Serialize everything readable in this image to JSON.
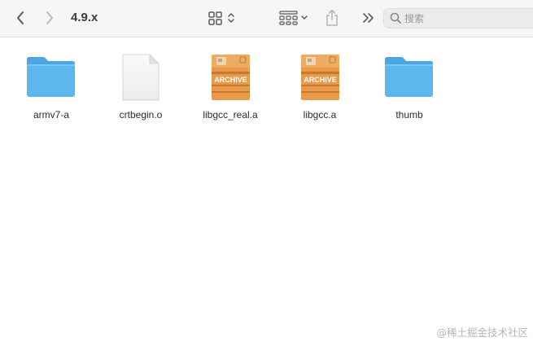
{
  "window": {
    "title": "4.9.x"
  },
  "toolbar": {
    "back_icon": "chevron-left-icon",
    "forward_icon": "chevron-right-icon",
    "view_icon": "grid-view-icon",
    "group_icon": "group-by-icon",
    "share_icon": "share-icon",
    "more_icon": "more-chevrons-icon"
  },
  "search": {
    "placeholder": "搜索",
    "value": ""
  },
  "files": [
    {
      "name": "armv7-a",
      "kind": "folder"
    },
    {
      "name": "crtbegin.o",
      "kind": "document"
    },
    {
      "name": "libgcc_real.a",
      "kind": "archive",
      "badge": "ARCHIVE"
    },
    {
      "name": "libgcc.a",
      "kind": "archive",
      "badge": "ARCHIVE"
    },
    {
      "name": "thumb",
      "kind": "folder"
    }
  ],
  "watermark": "@稀土掘金技术社区",
  "colors": {
    "folder": "#5bb4ec",
    "archive": "#e59a48",
    "toolbar_bg": "#f6f6f6"
  }
}
